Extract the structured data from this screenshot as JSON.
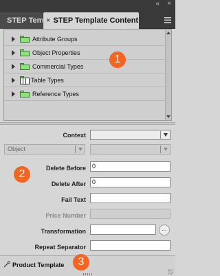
{
  "window": {
    "double_arrow_icon": "double-chevron-left-icon",
    "close_icon": "close-x-icon"
  },
  "tabs": [
    {
      "label": "STEP Tem",
      "active": false
    },
    {
      "label": "STEP Template Content",
      "active": true,
      "close": "×"
    }
  ],
  "tree": {
    "items": [
      {
        "label": "Attribute Groups",
        "icon": "folder-icon"
      },
      {
        "label": "Object Properties",
        "icon": "folder-icon"
      },
      {
        "label": "Commercial Types",
        "icon": "folder-icon"
      },
      {
        "label": "Table Types",
        "icon": "table-icon"
      },
      {
        "label": "Reference Types",
        "icon": "folder-icon"
      }
    ]
  },
  "callouts": [
    "1",
    "2",
    "3"
  ],
  "form": {
    "context_label": "Context",
    "context_value": "",
    "object_type": "Object",
    "object_subtype": "",
    "delete_before_label": "Delete Before",
    "delete_before_value": "0",
    "delete_after_label": "Delete After",
    "delete_after_value": "0",
    "fail_text_label": "Fail Text",
    "fail_text_value": "",
    "price_number_label": "Price Number",
    "price_number_value": "",
    "transformation_label": "Transformation",
    "transformation_value": "",
    "transformation_button": "...",
    "repeat_separator_label": "Repeat Separator",
    "repeat_separator_value": ""
  },
  "statusbar": {
    "label": "Product Template"
  },
  "colors": {
    "callout": "#f26522",
    "panel_bg": "#d6d6d6",
    "dark_bar": "#3a3a3a",
    "folder_green": "#8be37a"
  }
}
